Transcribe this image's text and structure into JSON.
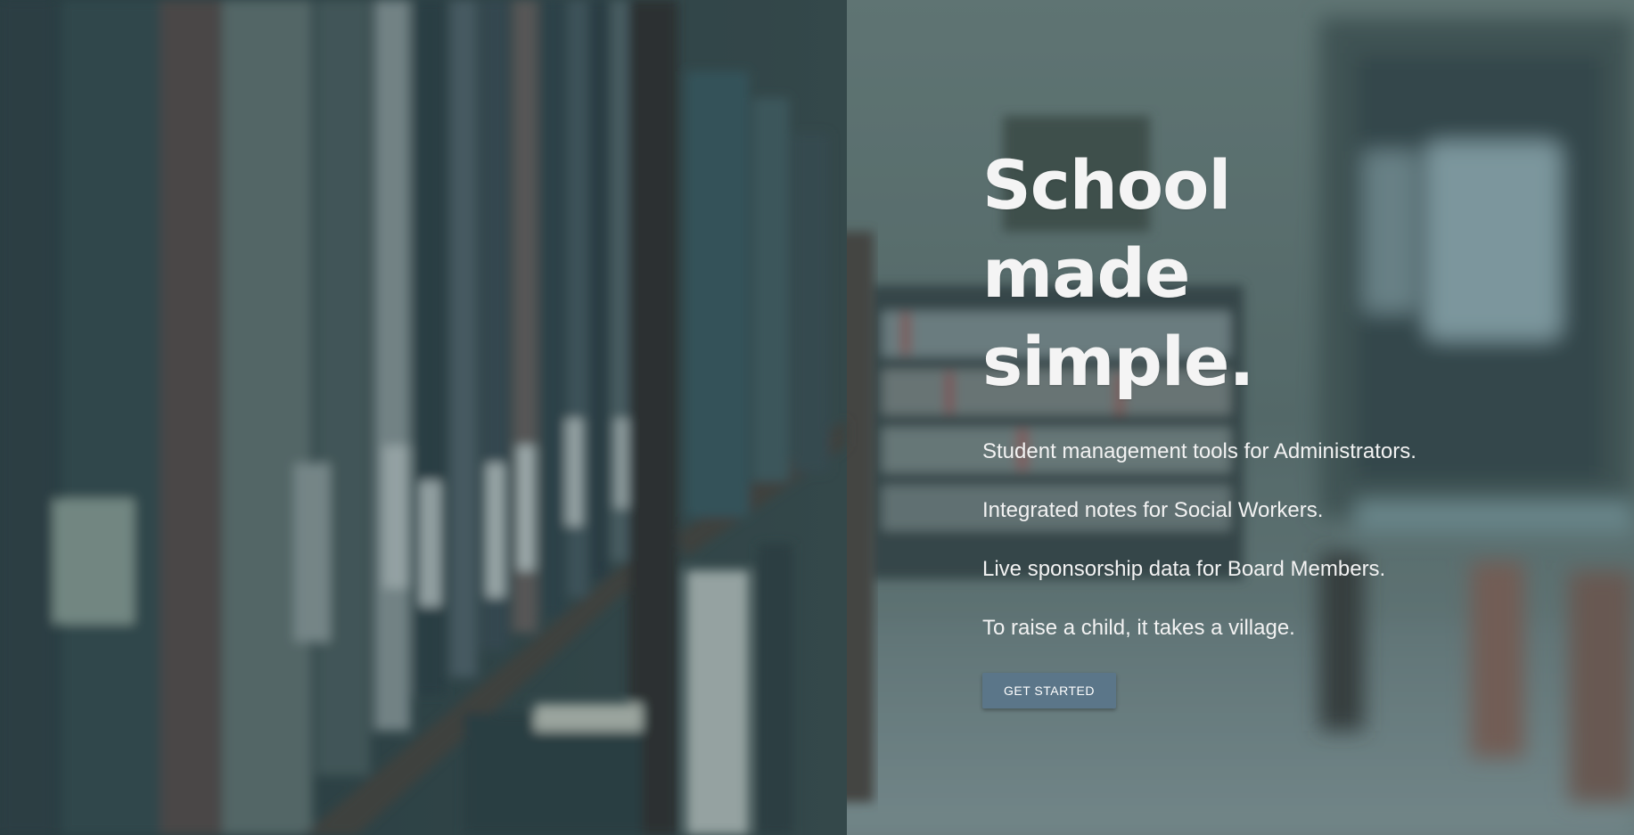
{
  "hero": {
    "headline_lines": [
      "School",
      "made",
      "simple."
    ],
    "taglines": [
      "Student management tools for Administrators.",
      "Integrated notes for Social Workers.",
      "Live sponsorship data for Board Members.",
      "To raise a child, it takes a village."
    ],
    "cta_label": "GET STARTED",
    "background_description": "library-bookshelf-photo",
    "colors": {
      "overlay": "#284650",
      "button": "#5b7689",
      "text": "#f4f4f4"
    }
  }
}
